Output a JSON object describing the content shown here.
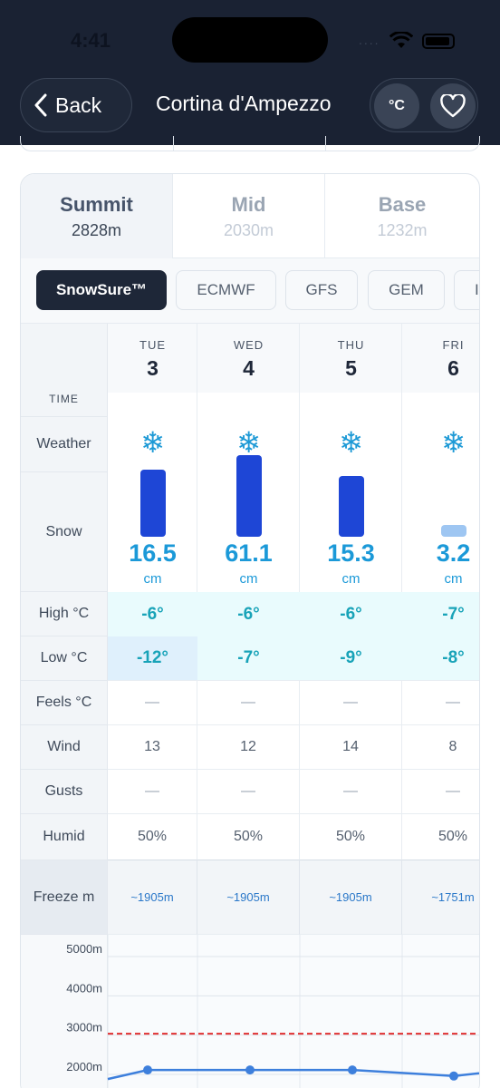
{
  "status": {
    "time": "4:41",
    "dots": "...."
  },
  "header": {
    "back_label": "Back",
    "title": "Cortina d'Ampezzo",
    "unit_label": "°C"
  },
  "elevation_tabs": [
    {
      "name": "Summit",
      "elevation": "2828m",
      "active": true
    },
    {
      "name": "Mid",
      "elevation": "2030m",
      "active": false
    },
    {
      "name": "Base",
      "elevation": "1232m",
      "active": false
    }
  ],
  "models": [
    "SnowSure™",
    "ECMWF",
    "GFS",
    "GEM",
    "I"
  ],
  "row_labels": {
    "time": "TIME",
    "weather": "Weather",
    "snow": "Snow",
    "high": "High °C",
    "low": "Low °C",
    "feels": "Feels °C",
    "wind": "Wind",
    "gusts": "Gusts",
    "humid": "Humid",
    "freeze": "Freeze m"
  },
  "days": [
    {
      "dow": "TUE",
      "num": "3",
      "snow": "16.5",
      "snow_fill": 0.46,
      "unit": "cm",
      "high": "-6°",
      "low": "-12°",
      "feels": "—",
      "wind": "13",
      "gusts": "—",
      "humid": "50%",
      "freeze": "~1905m"
    },
    {
      "dow": "WED",
      "num": "4",
      "snow": "61.1",
      "snow_fill": 0.56,
      "unit": "cm",
      "high": "-6°",
      "low": "-7°",
      "feels": "—",
      "wind": "12",
      "gusts": "—",
      "humid": "50%",
      "freeze": "~1905m"
    },
    {
      "dow": "THU",
      "num": "5",
      "snow": "15.3",
      "snow_fill": 0.42,
      "unit": "cm",
      "high": "-6°",
      "low": "-9°",
      "feels": "—",
      "wind": "14",
      "gusts": "—",
      "humid": "50%",
      "freeze": "~1905m"
    },
    {
      "dow": "FRI",
      "num": "6",
      "snow": "3.2",
      "snow_fill": 0.08,
      "unit": "cm",
      "high": "-7°",
      "low": "-8°",
      "feels": "—",
      "wind": "8",
      "gusts": "—",
      "humid": "50%",
      "freeze": "~1751m"
    }
  ],
  "freeze_chart": {
    "y_labels": [
      "5000m",
      "4000m",
      "3000m",
      "2000m"
    ],
    "y_values": [
      5000,
      4000,
      3000,
      2000
    ],
    "summit_line_m": 2828,
    "points_m": [
      1905,
      1905,
      1905,
      1751
    ],
    "line_color": "#3d7fdc",
    "summit_color": "#e03030"
  },
  "colors": {
    "header_bg": "#1a2233",
    "snow_bar": "#1e46d6",
    "accent": "#1b99d8"
  }
}
